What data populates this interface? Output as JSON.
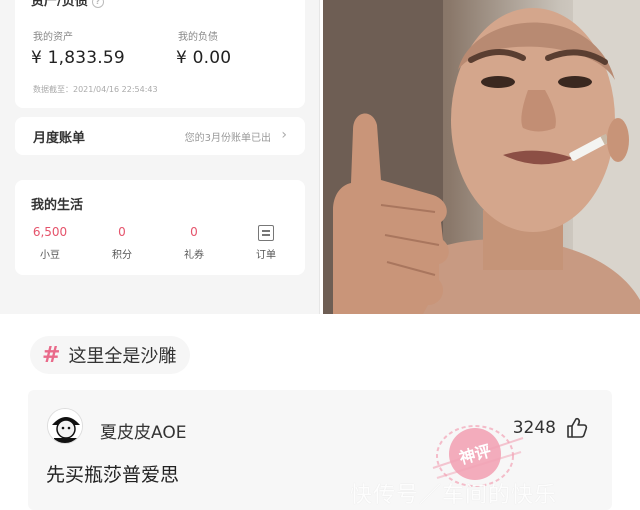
{
  "wallet": {
    "section_title": "资产/负债",
    "assets_label": "我的资产",
    "assets_value": "¥ 1,833.59",
    "debt_label": "我的负债",
    "debt_value": "¥ 0.00",
    "cutoff_text": "数据截至：2021/04/16 22:54:43",
    "bill_title": "月度账单",
    "bill_note": "您的3月份账单已出",
    "life_title": "我的生活",
    "life_items": [
      {
        "value": "6,500",
        "label": "小豆"
      },
      {
        "value": "0",
        "label": "积分"
      },
      {
        "value": "0",
        "label": "礼券"
      },
      {
        "icon": "order-icon",
        "label": "订单"
      }
    ]
  },
  "topic": {
    "icon": "hash-icon",
    "text": "这里全是沙雕"
  },
  "comment": {
    "username": "夏皮皮AOE",
    "likes": "3248",
    "text": "先买瓶莎普爱思",
    "stamp_text": "神评"
  },
  "watermark": "快传号／车间的快乐",
  "colors": {
    "accent_pink": "#e96a8a",
    "life_value_red": "#e5536b",
    "stamp_pink": "#f2a3b5"
  }
}
